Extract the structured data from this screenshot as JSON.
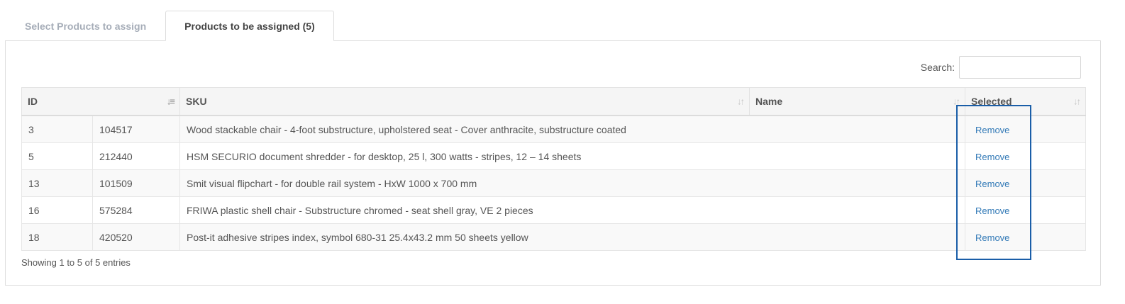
{
  "tabs": [
    {
      "label": "Select Products to assign",
      "active": false
    },
    {
      "label": "Products to be assigned (5)",
      "active": true
    }
  ],
  "search": {
    "label": "Search:",
    "value": "",
    "placeholder": ""
  },
  "table": {
    "headers": [
      "ID",
      "SKU",
      "Name",
      "Selected"
    ],
    "rows": [
      {
        "id": "3",
        "sku": "104517",
        "name": "Wood stackable chair - 4-foot substructure, upholstered seat - Cover anthracite, substructure coated",
        "action": "Remove"
      },
      {
        "id": "5",
        "sku": "212440",
        "name": "HSM SECURIO document shredder - for desktop, 25 l, 300 watts - stripes, 12 – 14 sheets",
        "action": "Remove"
      },
      {
        "id": "13",
        "sku": "101509",
        "name": "Smit visual flipchart - for double rail system - HxW 1000 x 700 mm",
        "action": "Remove"
      },
      {
        "id": "16",
        "sku": "575284",
        "name": "FRIWA plastic shell chair - Substructure chromed - seat shell gray, VE 2 pieces",
        "action": "Remove"
      },
      {
        "id": "18",
        "sku": "420520",
        "name": "Post-it adhesive stripes index, symbol 680-31 25.4x43.2 mm 50 sheets yellow",
        "action": "Remove"
      }
    ]
  },
  "info": "Showing 1 to 5 of 5 entries",
  "colors": {
    "link": "#337ab7",
    "highlight": "#1a5ea8"
  },
  "icons": {
    "sort_active": "sort-amount-asc-icon",
    "sort_default": "sort-both-icon"
  }
}
